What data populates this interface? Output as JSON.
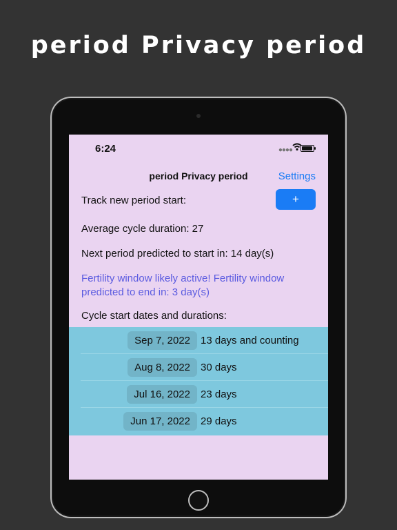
{
  "headline": "period Privacy period",
  "status": {
    "time": "6:24"
  },
  "nav": {
    "title": "period Privacy period",
    "settings_label": "Settings"
  },
  "track": {
    "label": "Track new period start:",
    "add_label": "+"
  },
  "stats": {
    "average": "Average cycle duration: 27",
    "next": "Next period predicted to start in: 14 day(s)",
    "fertility": "Fertility window likely active! Fertility window predicted to end in: 3 day(s)"
  },
  "history": {
    "title": "Cycle start dates and durations:",
    "rows": [
      {
        "date": "Sep 7, 2022",
        "duration": "13 days and counting"
      },
      {
        "date": "Aug 8, 2022",
        "duration": "30 days"
      },
      {
        "date": "Jul 16, 2022",
        "duration": "23 days"
      },
      {
        "date": "Jun 17, 2022",
        "duration": "29 days"
      }
    ]
  },
  "colors": {
    "background": "#333333",
    "screen": "#ead4f1",
    "accent": "#1a7cf5",
    "fertility_text": "#5b5be0",
    "list_bg": "#7ec8de"
  }
}
